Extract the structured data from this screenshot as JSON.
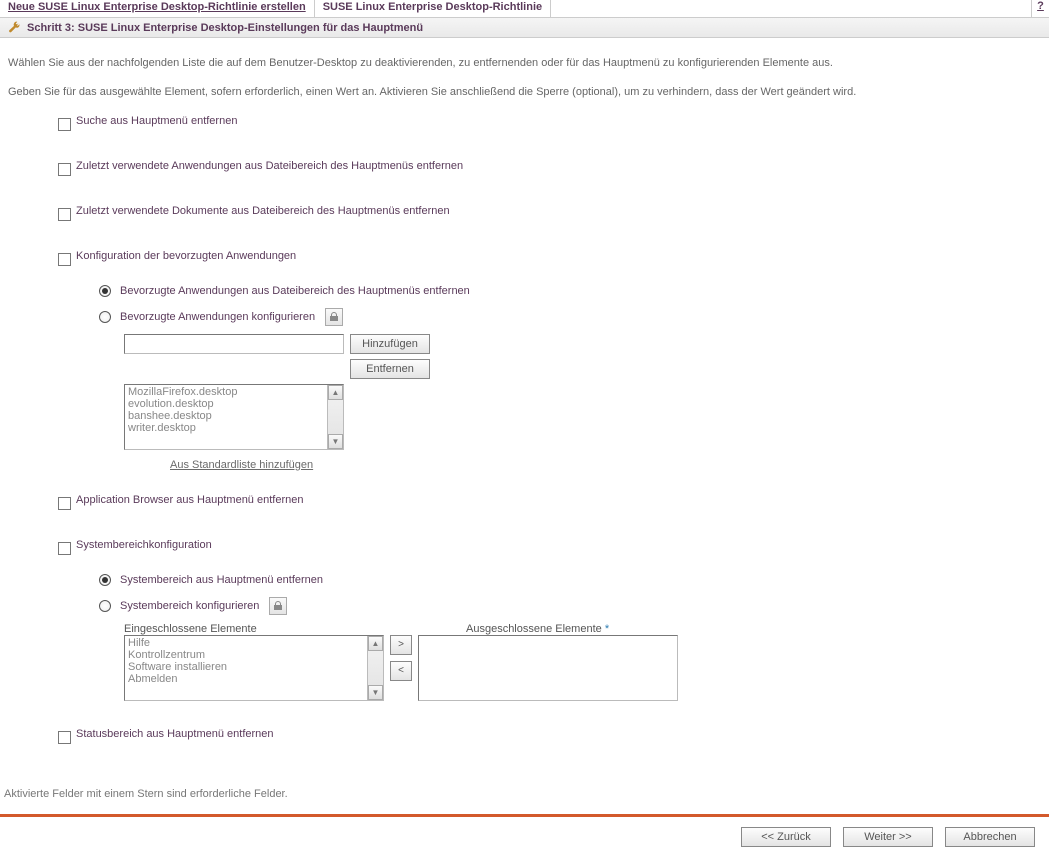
{
  "breadcrumb": {
    "link": "Neue SUSE Linux Enterprise Desktop-Richtlinie erstellen",
    "current": "SUSE Linux Enterprise Desktop-Richtlinie",
    "help": "?"
  },
  "step": {
    "title": "Schritt 3: SUSE Linux Enterprise Desktop-Einstellungen für das Hauptmenü"
  },
  "intro": {
    "p1": "Wählen Sie aus der nachfolgenden Liste die auf dem Benutzer-Desktop zu deaktivierenden, zu entfernenden oder für das Hauptmenü zu konfigurierenden Elemente aus.",
    "p2": "Geben Sie für das ausgewählte Element, sofern erforderlich, einen Wert an. Aktivieren Sie anschließend die Sperre (optional), um zu verhindern, dass der Wert geändert wird."
  },
  "opts": {
    "remove_search": "Suche aus Hauptmenü entfernen",
    "remove_recent_apps": "Zuletzt verwendete Anwendungen aus Dateibereich des Hauptmenüs entfernen",
    "remove_recent_docs": "Zuletzt verwendete Dokumente aus Dateibereich des Hauptmenüs entfernen",
    "fav_cfg": "Konfiguration der bevorzugten Anwendungen",
    "fav_remove": "Bevorzugte Anwendungen aus Dateibereich des Hauptmenüs entfernen",
    "fav_configure": "Bevorzugte Anwendungen konfigurieren",
    "add_btn": "Hinzufügen",
    "remove_btn": "Entfernen",
    "fav_items": [
      "MozillaFirefox.desktop",
      "evolution.desktop",
      "banshee.desktop",
      "writer.desktop"
    ],
    "std_link": "Aus Standardliste hinzufügen",
    "remove_app_browser": "Application Browser aus Hauptmenü entfernen",
    "sys_cfg": "Systembereichkonfiguration",
    "sys_remove": "Systembereich aus Hauptmenü entfernen",
    "sys_configure": "Systembereich konfigurieren",
    "included_label": "Eingeschlossene Elemente",
    "excluded_label": "Ausgeschlossene Elemente",
    "included_items": [
      "Hilfe",
      "Kontrollzentrum",
      "Software installieren",
      "Abmelden"
    ],
    "remove_status": "Statusbereich aus Hauptmenü entfernen"
  },
  "footnote": "Aktivierte Felder mit einem Stern sind erforderliche Felder.",
  "footer": {
    "back": "<< Zurück",
    "next": "Weiter >>",
    "cancel": "Abbrechen"
  }
}
